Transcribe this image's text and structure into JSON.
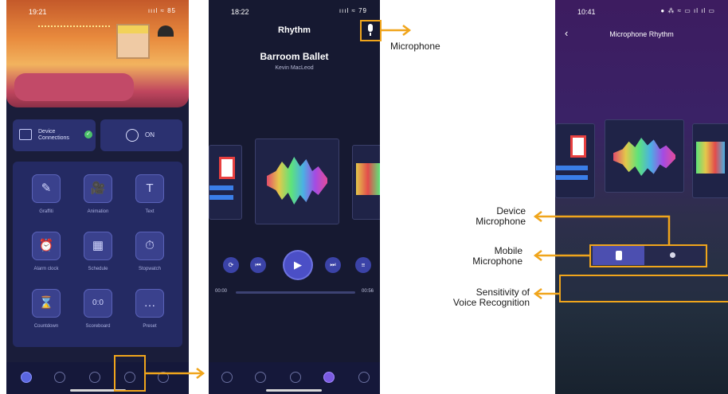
{
  "phone1": {
    "status_time": "19:21",
    "status_icons": "ıııl ≈ 85",
    "device_btn_label": "Device Connections",
    "on_btn_label": "ON",
    "grid_items": [
      {
        "icon": "graffiti-icon",
        "glyph": "✎",
        "label": "Graffiti"
      },
      {
        "icon": "animation-icon",
        "glyph": "🎥",
        "label": "Animation"
      },
      {
        "icon": "text-icon",
        "glyph": "T",
        "label": "Text"
      },
      {
        "icon": "alarm-clock-icon",
        "glyph": "⏰",
        "label": "Alarm clock"
      },
      {
        "icon": "schedule-icon",
        "glyph": "▦",
        "label": "Schedule"
      },
      {
        "icon": "stopwatch-icon",
        "glyph": "⏱",
        "label": "Stopwatch"
      },
      {
        "icon": "countdown-icon",
        "glyph": "⌛",
        "label": "Countdown"
      },
      {
        "icon": "scoreboard-icon",
        "glyph": "0:0",
        "label": "Scoreboard"
      },
      {
        "icon": "preset-icon",
        "glyph": "…",
        "label": "Preset"
      }
    ]
  },
  "phone2": {
    "status_time": "18:22",
    "status_icons": "ıııl ≈ 79",
    "title": "Rhythm",
    "song": "Barroom Ballet",
    "artist": "Kevin MacLeod",
    "time_start": "00:00",
    "time_end": "00:56"
  },
  "phone3": {
    "status_time": "10:41",
    "status_icons": "● ⁂ ≈ ▭ ıl ıl ▭",
    "title": "Microphone Rhythm"
  },
  "annotations": {
    "microphone": "Microphone",
    "device_microphone": "Device\nMicrophone",
    "mobile_microphone": "Mobile\nMicrophone",
    "sensitivity": "Sensitivity of\nVoice Recognition"
  },
  "colors": {
    "accent": "#f0a51c",
    "dark_bg": "#1a1d3a"
  }
}
